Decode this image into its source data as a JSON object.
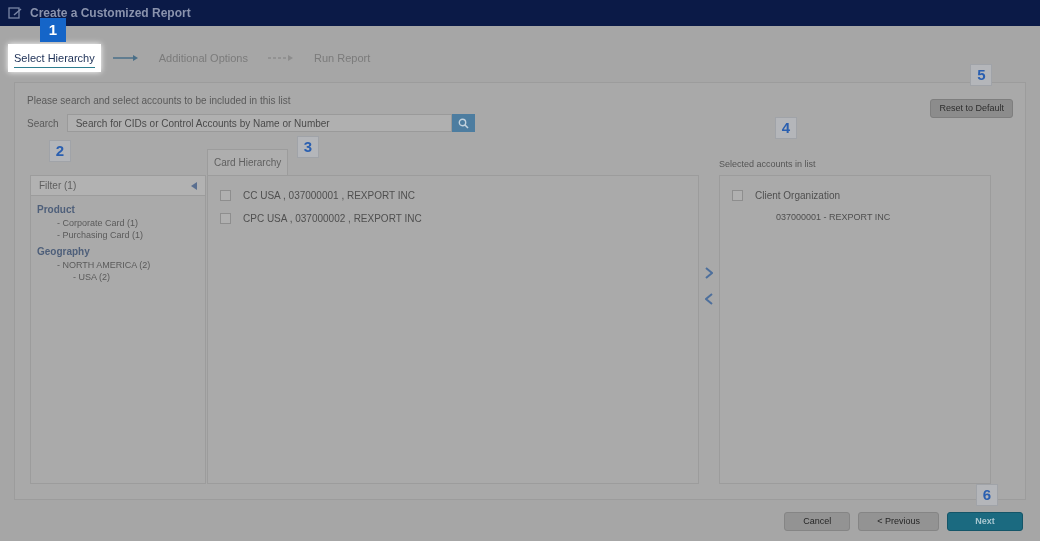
{
  "window": {
    "title": "Create a Customized Report"
  },
  "steps": [
    {
      "label": "Select Hierarchy",
      "selected": true,
      "callout": "1"
    },
    {
      "label": "Additional Options",
      "selected": false
    },
    {
      "label": "Run Report",
      "selected": false
    }
  ],
  "instructions": "Please search and select accounts to be included in this list",
  "search": {
    "label": "Search",
    "placeholder": "Search for CIDs or Control Accounts by Name or Number"
  },
  "reset_button": {
    "label": "Reset to Default",
    "callout": "5"
  },
  "filter": {
    "title": "Filter (1)",
    "callout": "2",
    "groups": [
      {
        "label": "Product",
        "items": [
          {
            "label": "- Corporate Card (1)"
          },
          {
            "label": "- Purchasing Card (1)"
          }
        ]
      },
      {
        "label": "Geography",
        "items": [
          {
            "label": "- NORTH AMERICA (2)",
            "children": [
              {
                "label": "- USA (2)"
              }
            ]
          }
        ]
      }
    ]
  },
  "hierarchy": {
    "tab": "Card Hierarchy",
    "callout": "3",
    "rows": [
      {
        "label": "CC USA , 037000001 , REXPORT INC",
        "checked": false
      },
      {
        "label": "CPC USA , 037000002 , REXPORT INC",
        "checked": false
      }
    ]
  },
  "selected_list": {
    "label": "Selected accounts in list",
    "callout": "4",
    "rows": [
      {
        "label": "Client Organization",
        "checked": false,
        "children": [
          {
            "label": "037000001 - REXPORT INC"
          }
        ]
      }
    ]
  },
  "footer": {
    "callout": "6",
    "buttons": [
      {
        "label": "Cancel",
        "kind": "secondary"
      },
      {
        "label": "< Previous",
        "kind": "secondary"
      },
      {
        "label": "Next",
        "kind": "primary"
      }
    ]
  }
}
